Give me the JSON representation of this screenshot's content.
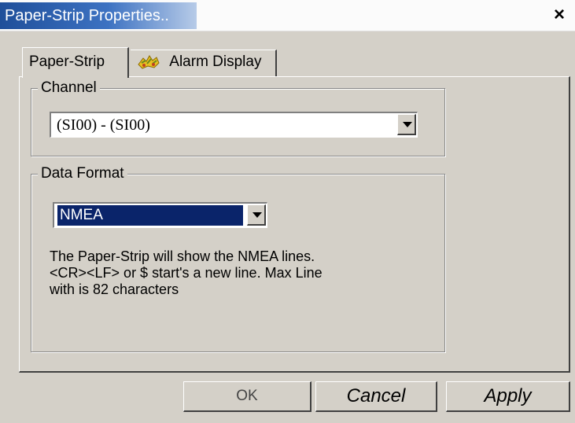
{
  "window": {
    "title": "Paper-Strip Properties..",
    "close_glyph": "×"
  },
  "tabs": [
    {
      "label": "Paper-Strip",
      "active": true
    },
    {
      "label": "Alarm Display",
      "active": false,
      "icon": "alarm-display-icon"
    }
  ],
  "channel": {
    "legend": "Channel",
    "selected_value": "(SI00)  - (SI00)"
  },
  "data_format": {
    "legend": "Data Format",
    "selected_value": "NMEA",
    "description_lines": [
      "The Paper-Strip will show the NMEA lines.",
      "<CR><LF> or $ start's a new line. Max Line",
      "with is 82 characters"
    ]
  },
  "buttons": {
    "ok": "OK",
    "cancel": "Cancel",
    "apply": "Apply"
  },
  "colors": {
    "title_bar_start": "#1f4f9a",
    "title_bar_end": "#b7cbe8",
    "selection": "#0a246a",
    "face": "#d4d0c8"
  }
}
